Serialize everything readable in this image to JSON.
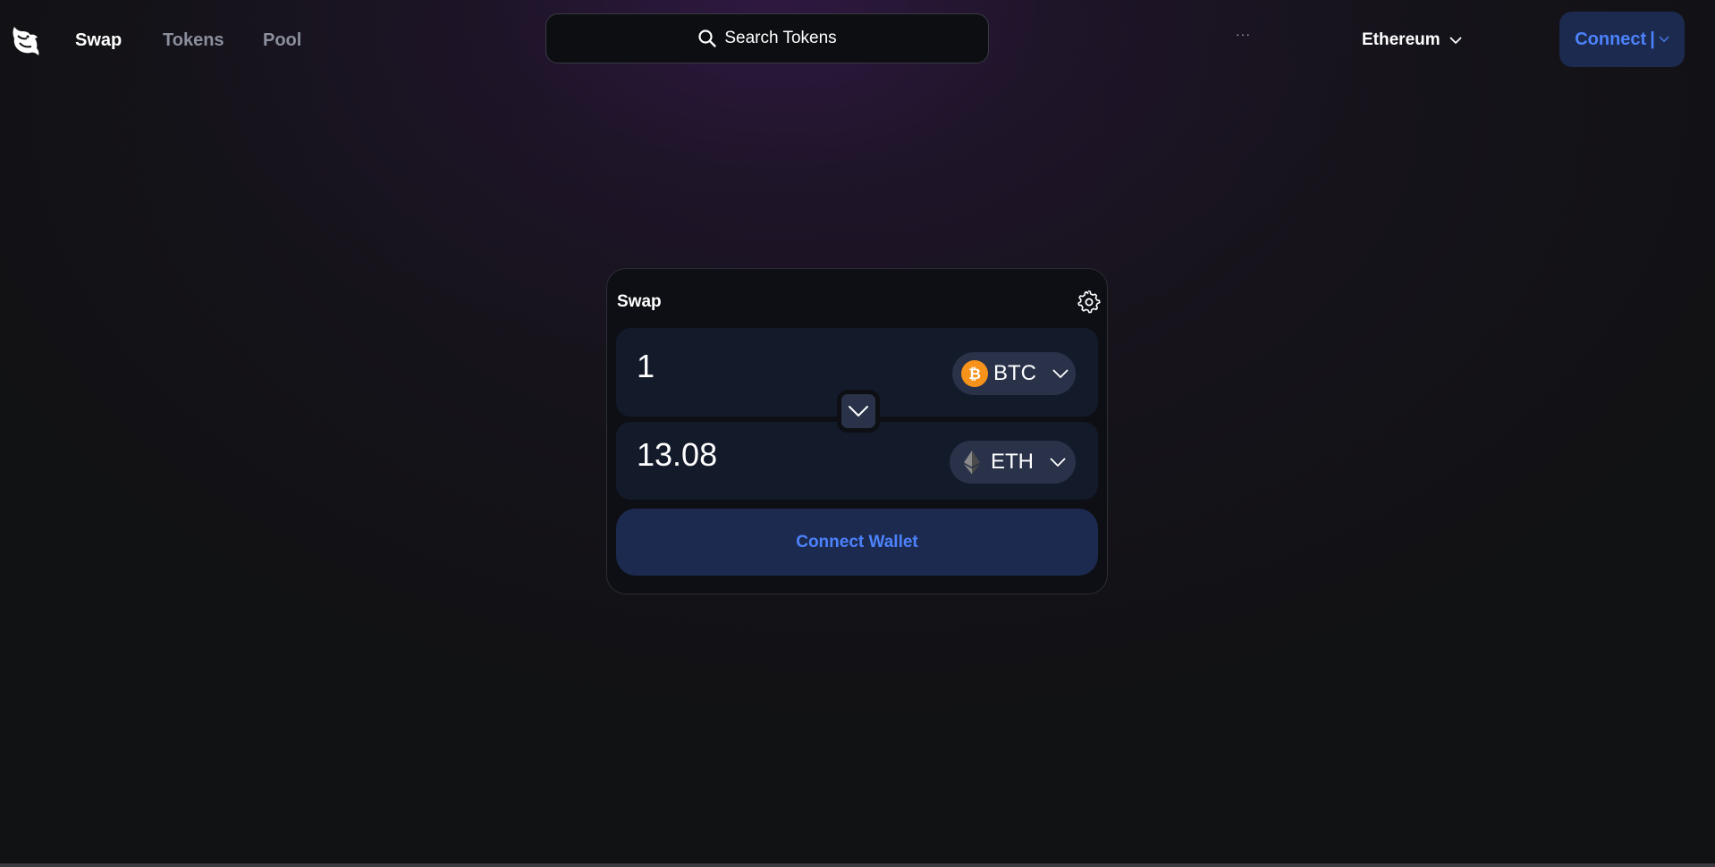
{
  "nav": {
    "links": [
      {
        "label": "Swap"
      },
      {
        "label": "Tokens"
      },
      {
        "label": "Pool"
      }
    ]
  },
  "search": {
    "placeholder": "Search Tokens"
  },
  "header": {
    "more": "···",
    "network": "Ethereum",
    "connect_label": "Connect",
    "connect_separator": "|"
  },
  "swap": {
    "title": "Swap",
    "from": {
      "amount": "1",
      "token": "BTC",
      "icon": "bitcoin-icon"
    },
    "to": {
      "amount": "13.08",
      "token": "ETH",
      "icon": "ethereum-icon"
    },
    "cta": "Connect Wallet"
  },
  "colors": {
    "accent": "#4c82fb",
    "button_bg": "#1c2a4f",
    "bitcoin": "#f7931a"
  }
}
